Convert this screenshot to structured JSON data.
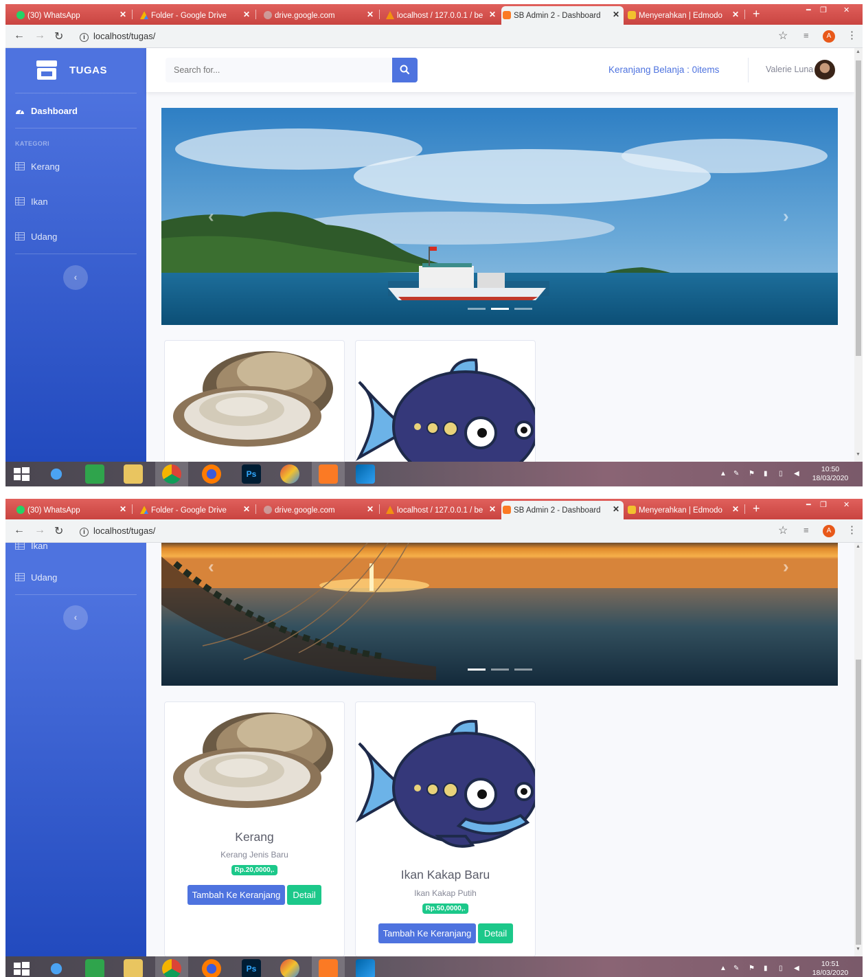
{
  "browser": {
    "tabs": [
      {
        "label": "(30) WhatsApp",
        "icon": "whatsapp-icon",
        "active": false
      },
      {
        "label": "Folder - Google Drive",
        "icon": "google-drive-icon",
        "active": false
      },
      {
        "label": "drive.google.com",
        "icon": "globe-icon",
        "active": false
      },
      {
        "label": "localhost / 127.0.0.1 / be",
        "icon": "phpmyadmin-icon",
        "active": false
      },
      {
        "label": "SB Admin 2 - Dashboard",
        "icon": "xampp-icon",
        "active": true
      },
      {
        "label": "Menyerahkan | Edmodo",
        "icon": "edmodo-icon",
        "active": false
      }
    ],
    "url": "localhost/tugas/",
    "profile_initial": "A"
  },
  "sidebar": {
    "brand": "TUGAS",
    "dashboard": "Dashboard",
    "heading": "KATEGORI",
    "items": [
      {
        "label": "Kerang"
      },
      {
        "label": "Ikan"
      },
      {
        "label": "Udang"
      }
    ],
    "toggle_icon": "chevron-left-icon"
  },
  "topbar": {
    "search_placeholder": "Search for...",
    "cart_label": "Keranjang Belanja : 0items",
    "user_name": "Valerie Luna"
  },
  "products": [
    {
      "title": "Kerang",
      "description": "Kerang Jenis Baru",
      "price": "Rp.20,0000,.",
      "add_label": "Tambah Ke Keranjang",
      "detail_label": "Detail"
    },
    {
      "title": "Ikan Kakap Baru",
      "description": "Ikan Kakap Putih",
      "price": "Rp.50,0000,.",
      "add_label": "Tambah Ke Keranjang",
      "detail_label": "Detail"
    }
  ],
  "taskbar": {
    "clock1": {
      "time": "10:50",
      "date": "18/03/2020"
    },
    "clock2": {
      "time": "10:51",
      "date": "18/03/2020"
    }
  },
  "colors": {
    "primary": "#4e73df",
    "success": "#1cc88a",
    "browser_tab": "#d9534f"
  }
}
